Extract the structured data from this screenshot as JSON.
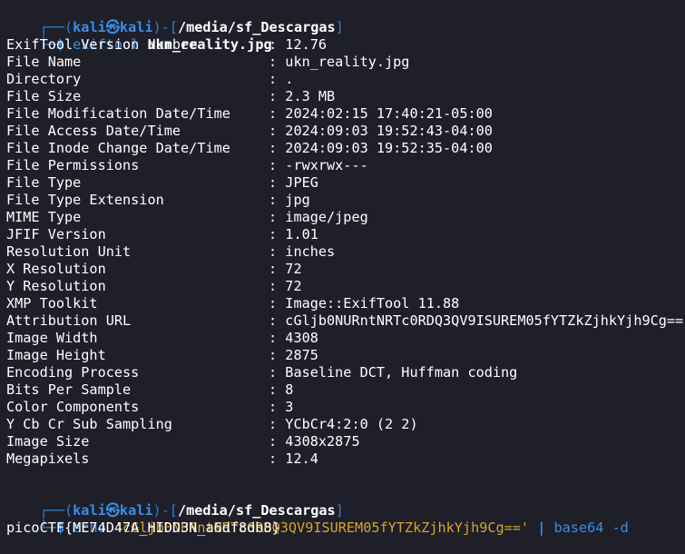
{
  "prompt1": {
    "corner_top": "┌──(",
    "user": "kali",
    "at": "㉿",
    "host": "kali",
    "mid": ")-[",
    "path": "/media/sf_Descargas",
    "close": "]",
    "corner_bottom": "└─",
    "dollar": "$ ",
    "command": "exiftool",
    "argument": " ukn_reality.jpg"
  },
  "exif_rows": [
    {
      "key": "ExifTool Version Number",
      "value": "12.76"
    },
    {
      "key": "File Name",
      "value": "ukn_reality.jpg"
    },
    {
      "key": "Directory",
      "value": "."
    },
    {
      "key": "File Size",
      "value": "2.3 MB"
    },
    {
      "key": "File Modification Date/Time",
      "value": "2024:02:15 17:40:21-05:00"
    },
    {
      "key": "File Access Date/Time",
      "value": "2024:09:03 19:52:43-04:00"
    },
    {
      "key": "File Inode Change Date/Time",
      "value": "2024:09:03 19:52:35-04:00"
    },
    {
      "key": "File Permissions",
      "value": "-rwxrwx---"
    },
    {
      "key": "File Type",
      "value": "JPEG"
    },
    {
      "key": "File Type Extension",
      "value": "jpg"
    },
    {
      "key": "MIME Type",
      "value": "image/jpeg"
    },
    {
      "key": "JFIF Version",
      "value": "1.01"
    },
    {
      "key": "Resolution Unit",
      "value": "inches"
    },
    {
      "key": "X Resolution",
      "value": "72"
    },
    {
      "key": "Y Resolution",
      "value": "72"
    },
    {
      "key": "XMP Toolkit",
      "value": "Image::ExifTool 11.88"
    },
    {
      "key": "Attribution URL",
      "value": "cGljb0NURntNRTc0RDQ3QV9ISUREM05fYTZkZjhkYjh9Cg=="
    },
    {
      "key": "Image Width",
      "value": "4308"
    },
    {
      "key": "Image Height",
      "value": "2875"
    },
    {
      "key": "Encoding Process",
      "value": "Baseline DCT, Huffman coding"
    },
    {
      "key": "Bits Per Sample",
      "value": "8"
    },
    {
      "key": "Color Components",
      "value": "3"
    },
    {
      "key": "Y Cb Cr Sub Sampling",
      "value": "YCbCr4:2:0 (2 2)"
    },
    {
      "key": "Image Size",
      "value": "4308x2875"
    },
    {
      "key": "Megapixels",
      "value": "12.4"
    }
  ],
  "separator": ": ",
  "prompt2": {
    "corner_top": "┌──(",
    "user": "kali",
    "at": "㉿",
    "host": "kali",
    "mid": ")-[",
    "path": "/media/sf_Descargas",
    "close": "]",
    "corner_bottom": "└─",
    "dollar": "$ ",
    "command": "echo",
    "string_arg": " 'cGljb0NURntNRTc0RDQ3QV9ISUREM05fYTZkZjhkYjh9Cg=='",
    "pipe": " | ",
    "pipe_cmd": "base64 -d"
  },
  "output": "picoCTF{ME74D47A_HIDD3N_a6df8db8}",
  "colors": {
    "background": "#1e1f29",
    "prompt_blue": "#2f7fd0",
    "user_blue": "#3a8ee6",
    "string_orange": "#d8a42a",
    "text": "#ffffff"
  }
}
